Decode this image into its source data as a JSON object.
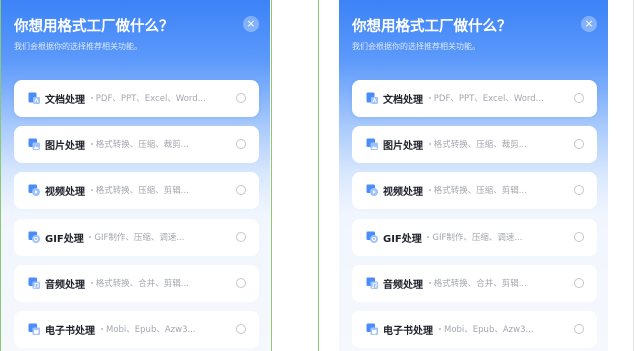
{
  "header": {
    "title": "你想用格式工厂做什么？",
    "subtitle": "我们会根据你的选择推荐相关功能。",
    "close_label": "×"
  },
  "colors": {
    "brand_blue": "#3c83f7",
    "option_bg": "#ffffff",
    "icon_blue": "#4a8df8"
  },
  "options": [
    {
      "label": "文档处理",
      "desc": "PDF、PPT、Excel、Word...",
      "icon": "document-icon"
    },
    {
      "label": "图片处理",
      "desc": "格式转换、压缩、裁剪...",
      "icon": "image-icon"
    },
    {
      "label": "视频处理",
      "desc": "格式转换、压缩、剪辑...",
      "icon": "video-icon"
    },
    {
      "label": "GIF处理",
      "desc": "GIF制作、压缩、调速...",
      "icon": "gif-icon"
    },
    {
      "label": "音频处理",
      "desc": "格式转换、合并、剪辑...",
      "icon": "audio-icon"
    },
    {
      "label": "电子书处理",
      "desc": "Mobi、Epub、Azw3...",
      "icon": "ebook-icon"
    }
  ]
}
